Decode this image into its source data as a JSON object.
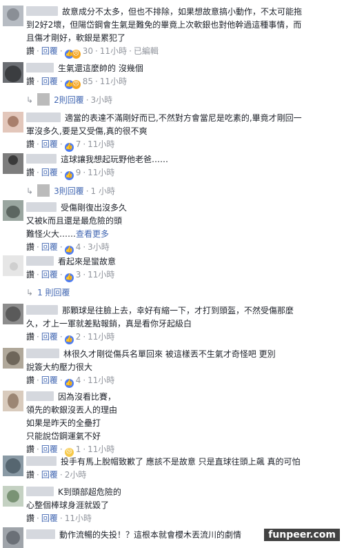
{
  "labels": {
    "like": "讚",
    "reply": "回覆",
    "edited": "已編輯",
    "see_more": "查看更多"
  },
  "comments": [
    {
      "text": "故意成分不太多，但也不排除，如果想故意搞小動作，不太可能拖\n到2好2壞，但陽岱鋼會生氣是難免的畢竟上次軟銀也對他幹過這種事情，而\n且傷才剛好，軟銀是累犯了",
      "reactions": "30",
      "time": "11小時",
      "edited": true
    },
    {
      "text": "生氣還這麼帥的 沒幾個",
      "reactions": "85",
      "time": "11小時",
      "replies": "2則回覆",
      "reply_time": "3小時"
    },
    {
      "text": "適當的表達不滿剛好而已,不然對方會當尼是吃素的,畢竟才剛回一\n軍沒多久,要是又受傷,真的很不爽",
      "reactions": "7",
      "time": "11小時"
    },
    {
      "text": "這球讓我想起玩野他老爸……",
      "reactions": "9",
      "time": "11小時",
      "replies": "3則回覆",
      "reply_time": "1 小時"
    },
    {
      "text": "受傷剛復出沒多久\n又被k而且還是最危險的頭\n難怪火大……",
      "reactions": "4",
      "time": "3小時",
      "see_more": true
    },
    {
      "text": "看起來是蠻故意",
      "reactions": "3",
      "time": "11小時",
      "replies": "1 則回覆"
    },
    {
      "text": "那顆球是往臉上去，幸好有縮一下，才打到頭盔，不然受傷那麼\n久，才上一軍就差點報銷，真是看你牙起級白",
      "reactions": "2",
      "time": "11小時"
    },
    {
      "text": "林很久才剛從傷兵名單回來 被這樣丟不生氣才奇怪吧 更別\n說簽大約壓力很大",
      "reactions": "4",
      "time": "11小時"
    },
    {
      "text": "因為沒看比賽，\n領先的軟銀沒丟人的理由\n如果是昨天的全壘打\n只能說岱鋼運氣不好",
      "reactions": "1",
      "time": "11小時"
    },
    {
      "text": "投手有馬上脫帽致歉了 應該不是故意 只是直球往頭上飆 真的可怕",
      "time": "2小時"
    },
    {
      "text": "K到頭部超危險的\n心整個棒球身涯就毀了",
      "time": "11小時"
    },
    {
      "text": "動作流暢的失投！？這根本就會櫻木丟流川的劇情"
    }
  ],
  "watermark": "funpeer.com",
  "colors": {
    "link": "#4267b2",
    "meta": "#90949c",
    "like": "#4c7cf3"
  }
}
